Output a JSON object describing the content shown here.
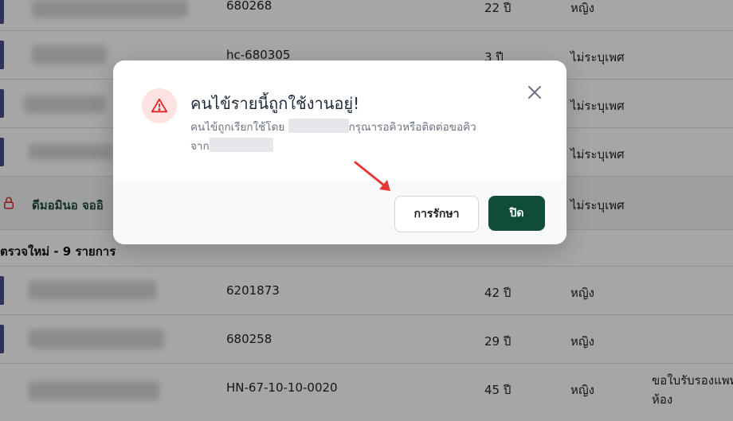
{
  "table": {
    "rows_top": [
      {
        "id": "680268",
        "age": "22 ปี",
        "gender": "หญิง"
      },
      {
        "id": "hc-680305",
        "age": "3 ปี",
        "gender": "ไม่ระบุเพศ"
      },
      {
        "id": "",
        "age": "",
        "gender": "ไม่ระบุเพศ"
      },
      {
        "id": "",
        "age": "",
        "gender": "ไม่ระบุเพศ"
      }
    ],
    "locked_row": {
      "name": "ดีมอมินอ  จออิ",
      "gender": "ไม่ระบุเพศ"
    },
    "section_label": "ตรวจใหม่ - 9 รายการ",
    "rows_bottom": [
      {
        "id": "6201873",
        "age": "42 ปี",
        "gender": "หญิง",
        "note": ""
      },
      {
        "id": "680258",
        "age": "29 ปี",
        "gender": "หญิง",
        "note": ""
      },
      {
        "id": "HN-67-10-10-0020",
        "age": "45 ปี",
        "gender": "หญิง",
        "note": "ขอใบรับรองแพท",
        "note2": "ห้อง"
      }
    ]
  },
  "modal": {
    "title": "คนไข้รายนี้ถูกใช้งานอยู่!",
    "message_part1": "คนไข้ถูกเรียกใช้โดย",
    "message_part2": "กรุณารอคิวหรือติดต่อขอคิว",
    "message_part3": "จาก",
    "secondary_button": "การรักษา",
    "primary_button": "ปิด"
  },
  "colors": {
    "primary": "#0f4c3a",
    "warning": "#dc2626",
    "accent_bar": "#4a4e8a"
  }
}
